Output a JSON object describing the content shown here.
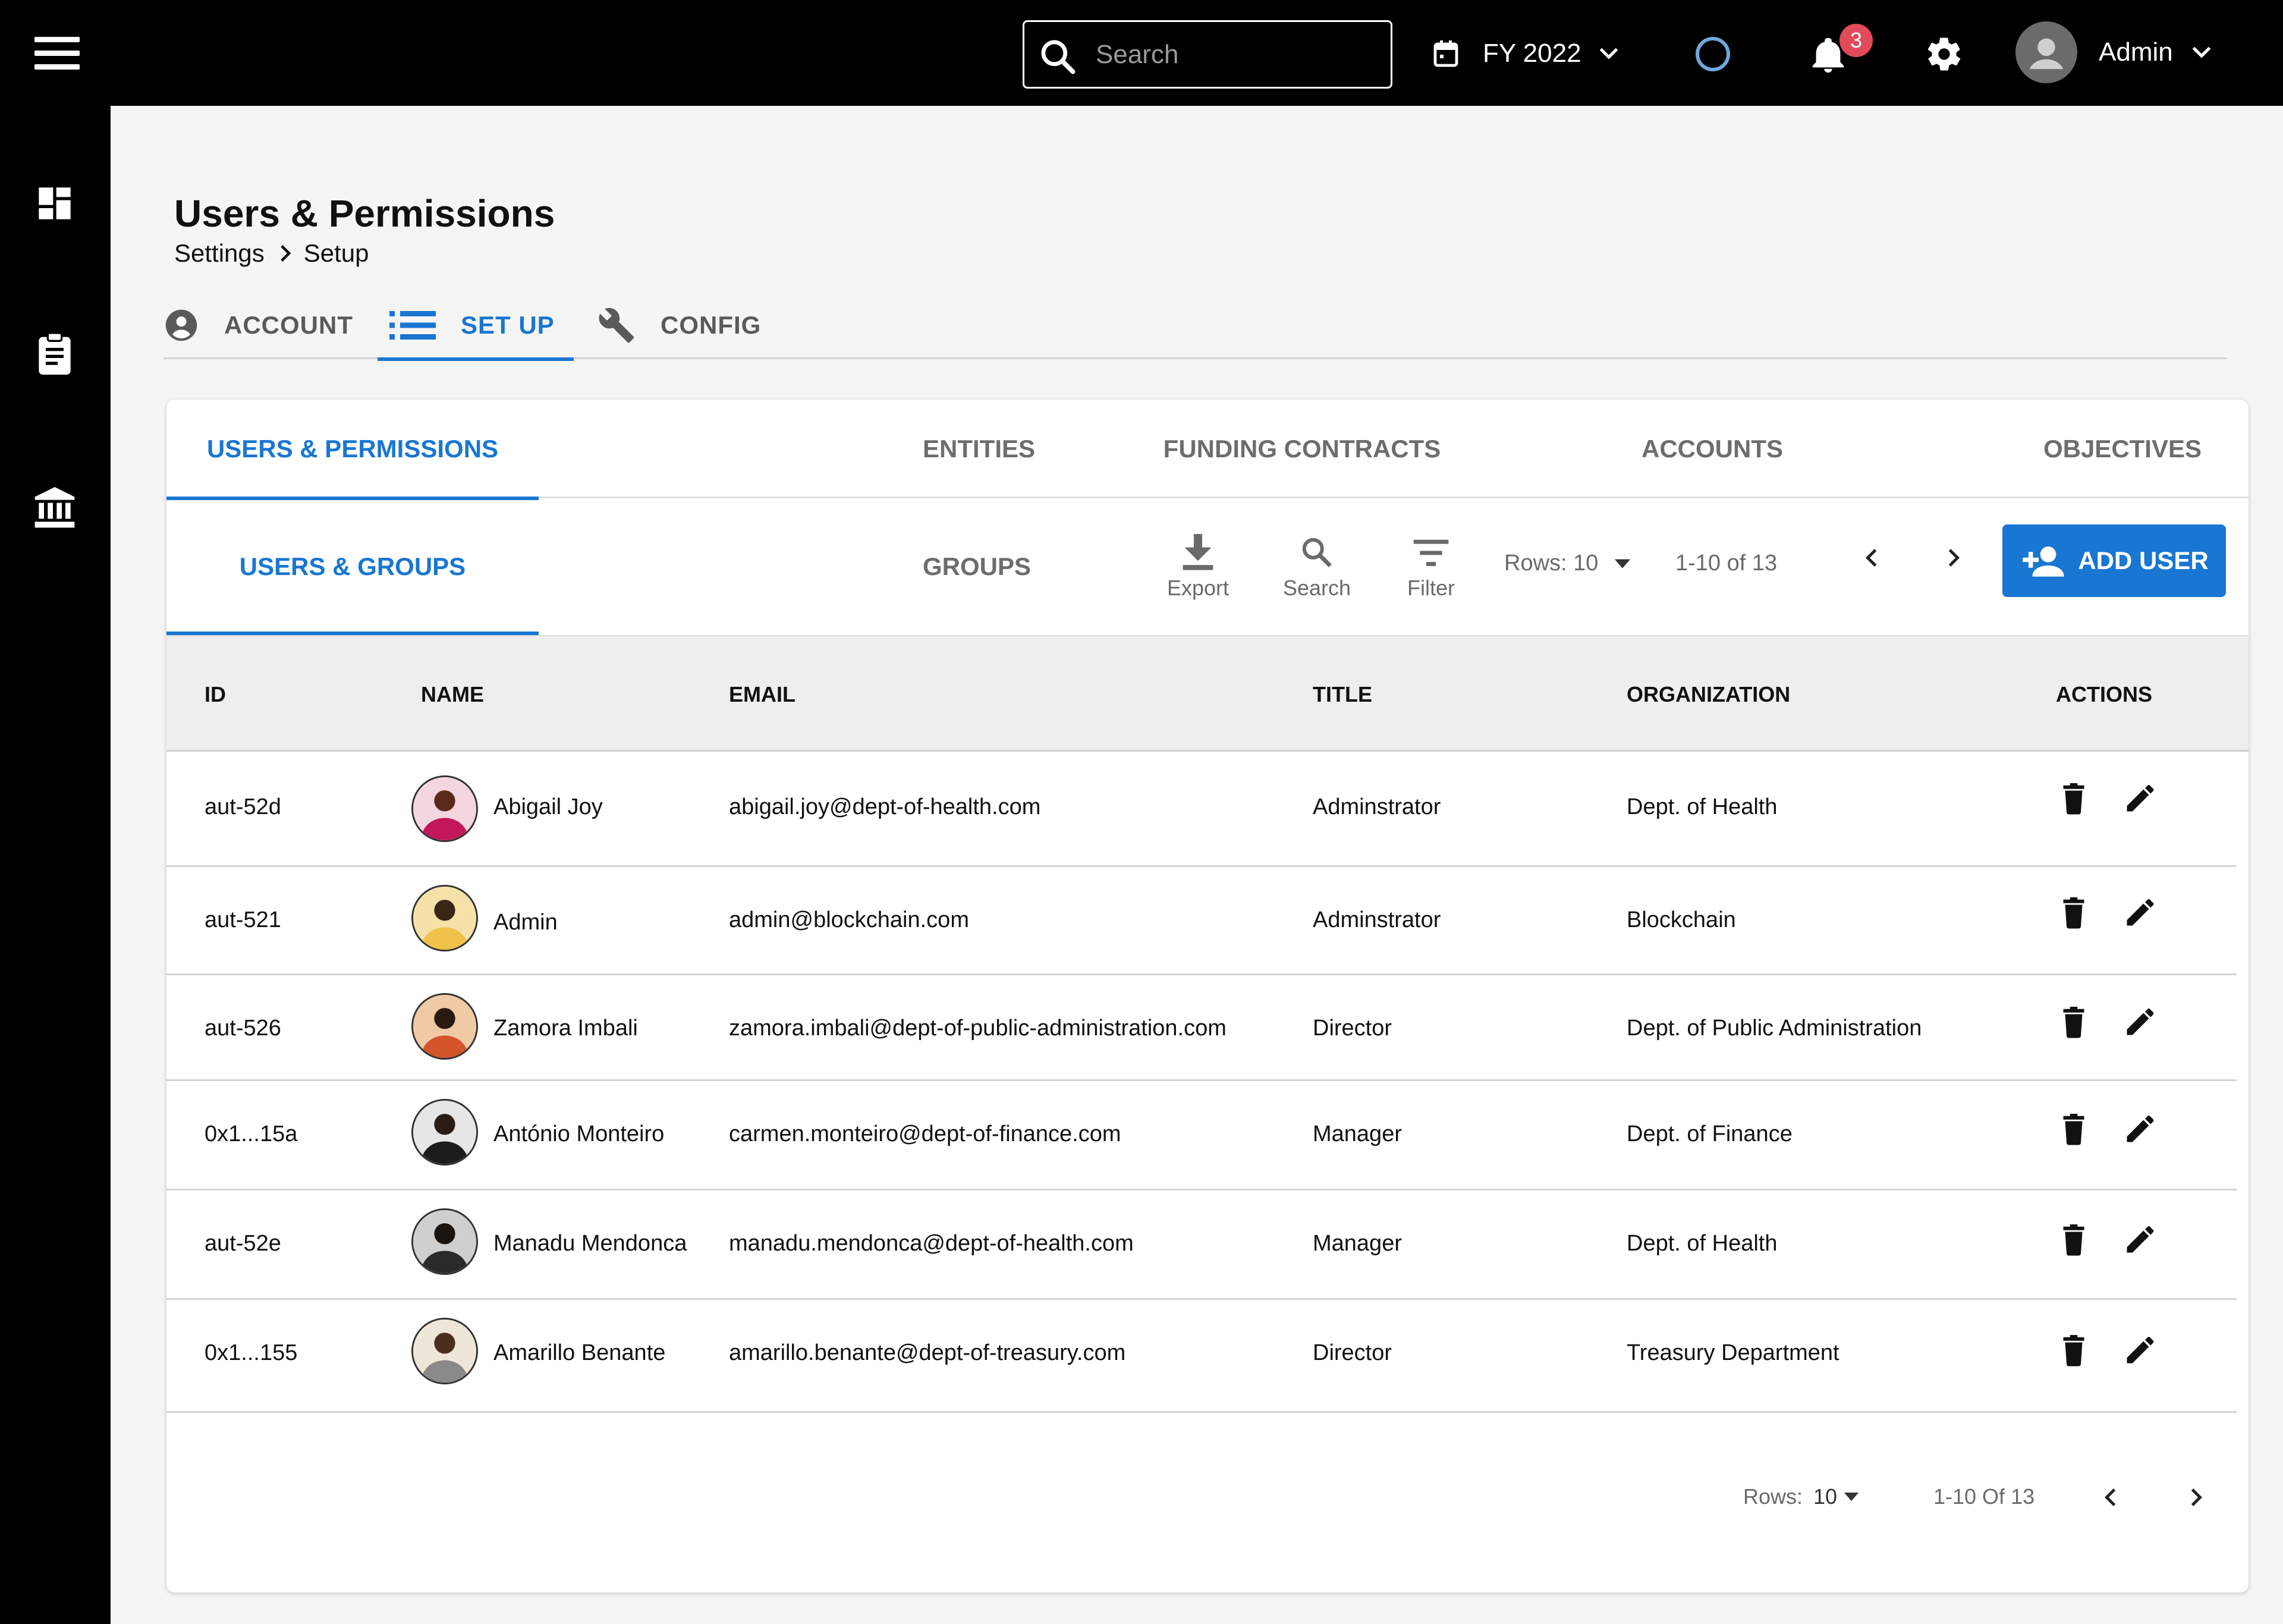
{
  "topbar": {
    "search_placeholder": "Search",
    "fiscal_year": "FY 2022",
    "notification_count": "3",
    "user_name": "Admin",
    "loading_color": "#6fa8dc",
    "badge_color": "#e14b5a"
  },
  "sidebar": {
    "icons": [
      "dashboard-icon",
      "clipboard-icon",
      "bank-icon"
    ]
  },
  "page": {
    "title": "Users & Permissions",
    "breadcrumb": [
      "Settings",
      "Setup"
    ]
  },
  "top_tabs": [
    {
      "label": "ACCOUNT",
      "icon": "account-circle-icon",
      "active": false
    },
    {
      "label": "SET UP",
      "icon": "list-icon",
      "active": true
    },
    {
      "label": "CONFIG",
      "icon": "wrench-icon",
      "active": false
    }
  ],
  "section_tabs": [
    {
      "label": "USERS & PERMISSIONS",
      "active": true
    },
    {
      "label": "ENTITIES",
      "active": false
    },
    {
      "label": "FUNDING CONTRACTS",
      "active": false
    },
    {
      "label": "ACCOUNTS",
      "active": false
    },
    {
      "label": "OBJECTIVES",
      "active": false
    }
  ],
  "sub_tabs": [
    {
      "label": "USERS & GROUPS",
      "active": true
    },
    {
      "label": "GROUPS",
      "active": false
    }
  ],
  "toolbar": {
    "export_label": "Export",
    "search_label": "Search",
    "filter_label": "Filter",
    "rows_label": "Rows: 10",
    "range_label": "1-10 of 13",
    "add_user_label": "ADD USER",
    "accent_color": "#1976d2"
  },
  "table": {
    "columns": [
      "ID",
      "NAME",
      "EMAIL",
      "TITLE",
      "ORGANIZATION",
      "ACTIONS"
    ],
    "rows": [
      {
        "id": "aut-52d",
        "name": "Abigail Joy",
        "email": "abigail.joy@dept-of-health.com",
        "title": "Adminstrator",
        "organization": "Dept. of Health"
      },
      {
        "id": "aut-521",
        "name": "Admin",
        "email": "admin@blockchain.com",
        "title": "Adminstrator",
        "organization": "Blockchain"
      },
      {
        "id": "aut-526",
        "name": "Zamora Imbali",
        "email": "zamora.imbali@dept-of-public-administration.com",
        "title": "Director",
        "organization": "Dept. of Public Administration"
      },
      {
        "id": "0x1...15a",
        "name": "António Monteiro",
        "email": "carmen.monteiro@dept-of-finance.com",
        "title": "Manager",
        "organization": "Dept. of Finance"
      },
      {
        "id": "aut-52e",
        "name": "Manadu Mendonca",
        "email": "manadu.mendonca@dept-of-health.com",
        "title": "Manager",
        "organization": "Dept. of Health"
      },
      {
        "id": "0x1...155",
        "name": "Amarillo Benante",
        "email": "amarillo.benante@dept-of-treasury.com",
        "title": "Director",
        "organization": "Treasury Department"
      }
    ]
  },
  "footer": {
    "rows_prefix": "Rows:",
    "rows_value": "10",
    "range_label": "1-10 Of 13"
  }
}
